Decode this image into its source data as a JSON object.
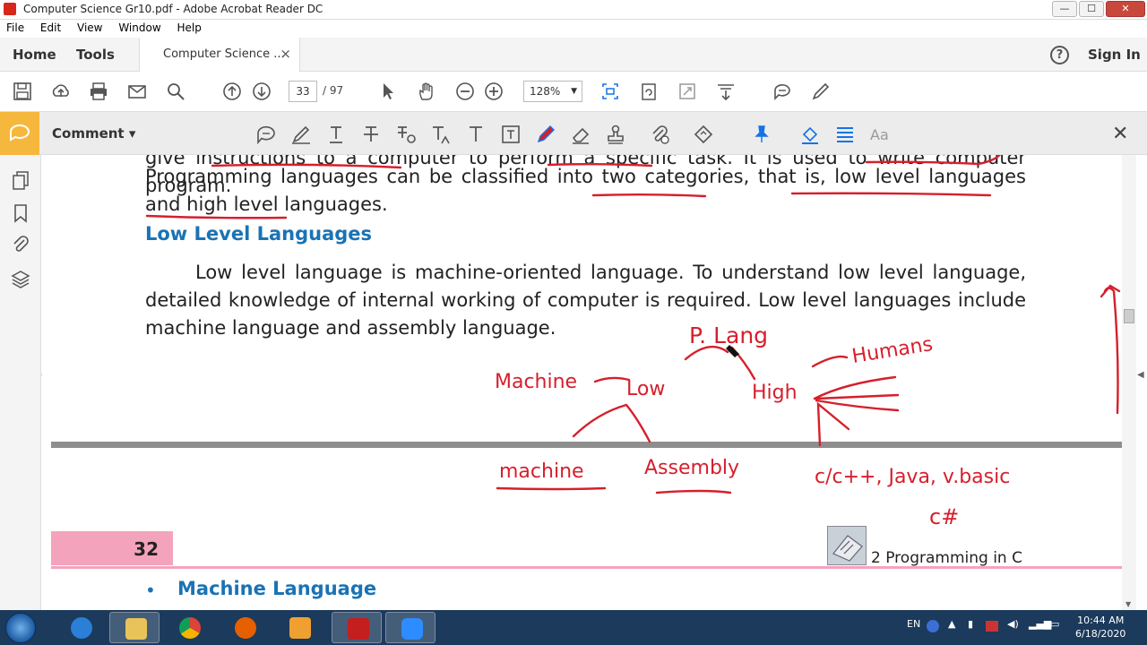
{
  "window": {
    "title": "Computer Science Gr10.pdf - Adobe Acrobat Reader DC",
    "min_label": "—",
    "max_label": "☐",
    "close_label": "✕"
  },
  "menu": {
    "items": [
      "File",
      "Edit",
      "View",
      "Window",
      "Help"
    ]
  },
  "tabs": {
    "home": "Home",
    "tools": "Tools",
    "doc_tab": "Computer Science ...",
    "doc_tab_close": "×",
    "help": "?",
    "sign_in": "Sign In"
  },
  "toolbar": {
    "page_current": "33",
    "page_total": "/  97",
    "zoom": "128%",
    "zoom_caret": "▼"
  },
  "comment_bar": {
    "label": "Comment ▾",
    "close": "✕"
  },
  "document": {
    "line_cut": "give instructions to a computer to perform a specific task. It is used to write computer program.",
    "para1": "Programming languages can be classified into two categories, that is, low level languages and high level languages.",
    "heading": "Low Level Languages",
    "para2": "Low level language is machine-oriented language. To understand low level language, detailed knowledge of internal working of computer is required. Low level languages include machine language and assembly language.",
    "page_number": "32",
    "chapter_title": "2 Programming in C",
    "bullet": "•",
    "next_heading": "Machine Language"
  },
  "annotations": {
    "root": "P. Lang",
    "low": "Low",
    "high": "High",
    "humans": "Humans",
    "machine_top": "Machine",
    "machine_bottom": "machine",
    "assembly": "Assembly",
    "examples": "c/c++, Java, v.basic",
    "csharp": "c#"
  },
  "taskbar": {
    "lang": "EN",
    "time": "10:44 AM",
    "date": "6/18/2020"
  },
  "colors": {
    "accent": "#f6b83c",
    "ink": "#d61f2c",
    "heading": "#1a73b4",
    "page_band": "#f4a3bd"
  }
}
